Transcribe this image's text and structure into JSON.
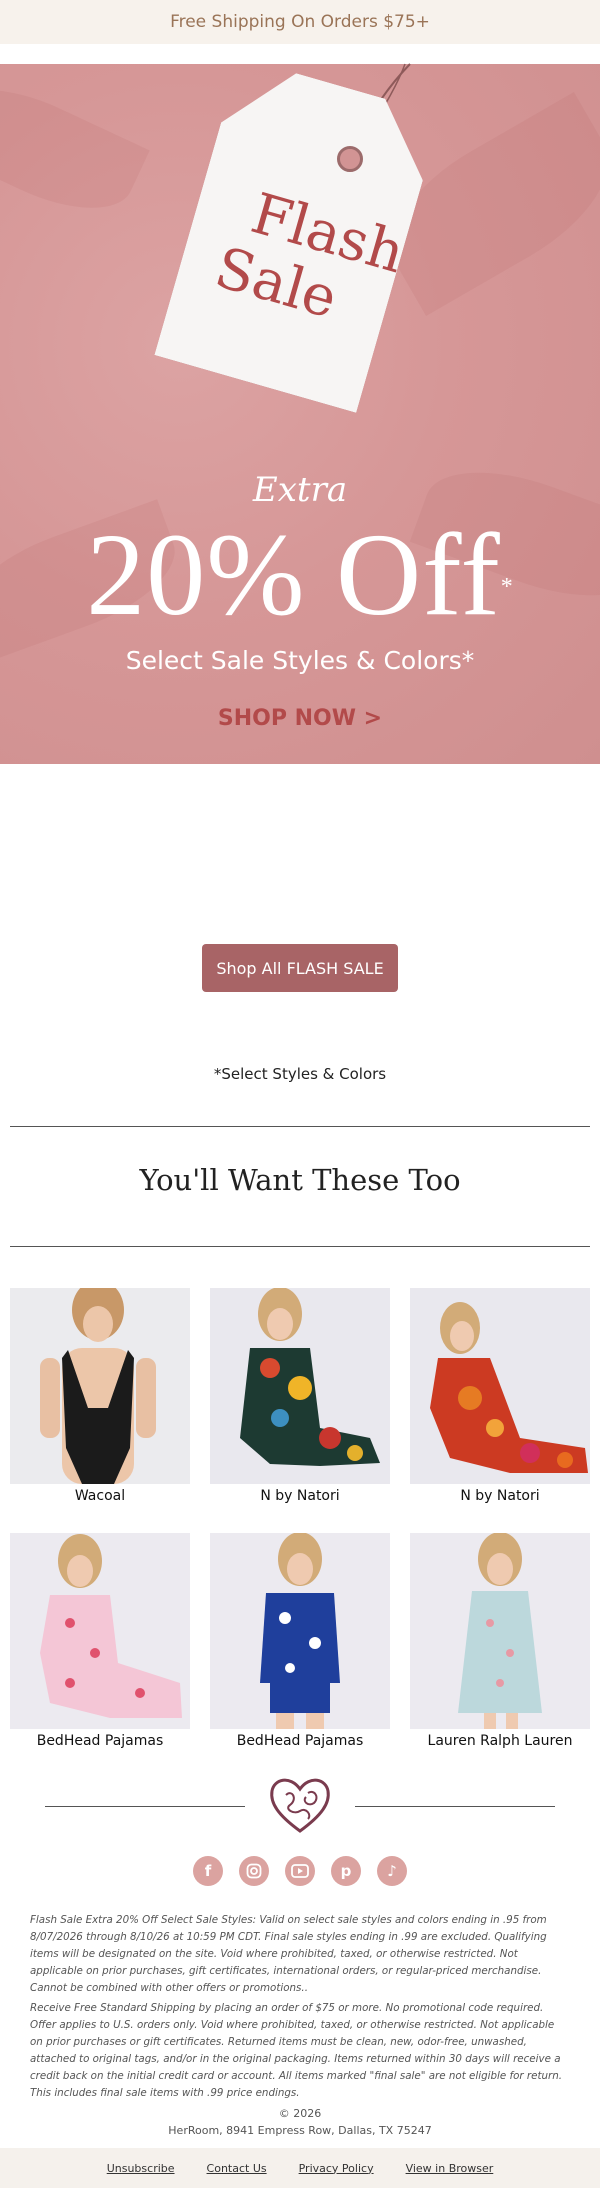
{
  "topbar": {
    "text": "Free Shipping On Orders $75+"
  },
  "hero": {
    "tag_line1": "Flash",
    "tag_line2": "Sale",
    "extra": "Extra",
    "offer": "20% Off",
    "offer_asterisk": "*",
    "subhead": "Select Sale Styles & Colors*",
    "shop_now": "SHOP NOW >"
  },
  "cta": {
    "label": "Shop All FLASH SALE"
  },
  "select_note": "*Select Styles & Colors",
  "section_title": "You'll Want These Too",
  "products": [
    {
      "brand": "Wacoal"
    },
    {
      "brand": "N by Natori"
    },
    {
      "brand": "N by Natori"
    },
    {
      "brand": "BedHead Pajamas"
    },
    {
      "brand": "BedHead Pajamas"
    },
    {
      "brand": "Lauren Ralph Lauren"
    }
  ],
  "social": [
    "facebook-icon",
    "instagram-icon",
    "youtube-icon",
    "pinterest-icon",
    "tiktok-icon"
  ],
  "legal": {
    "p1": "Flash Sale Extra 20% Off Select Sale Styles: Valid on select sale styles and colors ending in .95 from 8/07/2026 through 8/10/26 at 10:59 PM CDT. Final sale styles ending in .99 are excluded. Qualifying items will be designated on the site.  Void where prohibited, taxed, or otherwise restricted. Not applicable on prior purchases, gift certificates, international orders, or regular-priced merchandise. Cannot be combined with other offers or promotions..",
    "p2": "Receive Free Standard Shipping by placing an order of $75 or more. No promotional code required. Offer applies to U.S. orders only. Void where prohibited, taxed, or otherwise restricted. Not applicable on prior purchases or gift certificates. Returned items must be clean, new, odor-free, unwashed, attached to original tags, and/or in the original packaging. Items returned within 30 days will receive a credit back on the initial credit card or account. All items marked \"final sale\" are not eligible for return. This includes final sale items with .99 price endings."
  },
  "copyright": "© 2026",
  "address": "HerRoom, 8941 Empress Row, Dallas, TX 75247",
  "footer": {
    "unsubscribe": "Unsubscribe",
    "contact": "Contact Us",
    "privacy": "Privacy Policy",
    "browser": "View in Browser"
  },
  "colors": {
    "hero_bg": "#d69797",
    "accent": "#b24a4a",
    "cta_bg": "#a86466",
    "topbar_text": "#9a7457"
  }
}
